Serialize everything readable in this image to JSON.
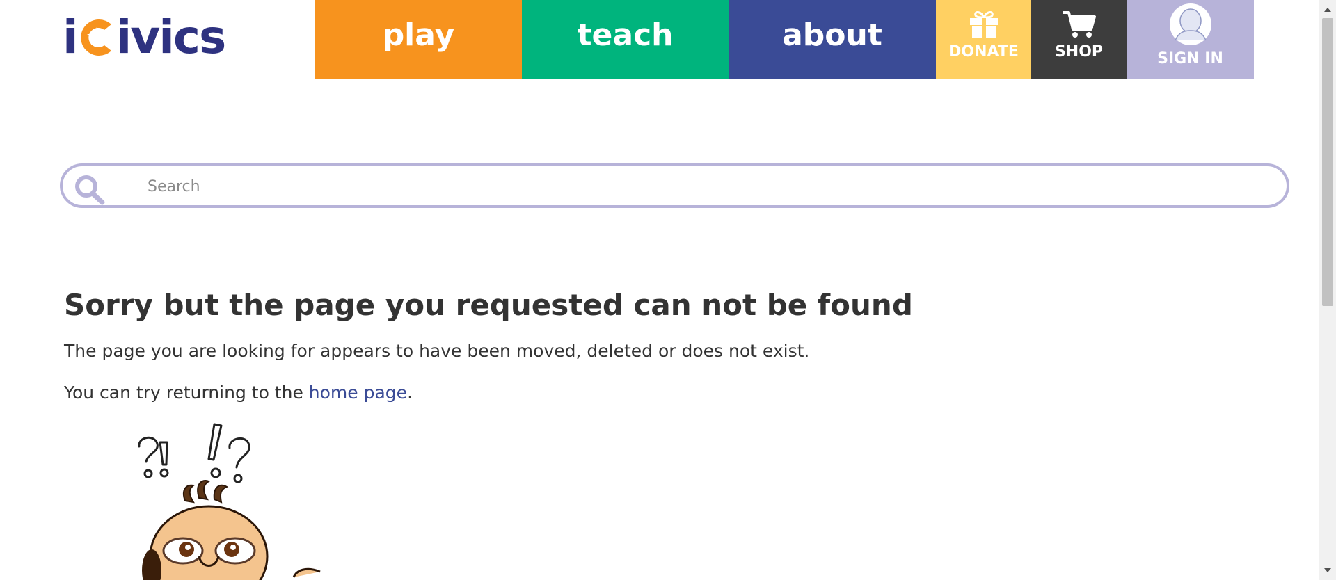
{
  "brand": {
    "logo_text": "iCivics",
    "logo_prefix": "i",
    "logo_suffix": "ivics",
    "colors": {
      "navy": "#2e3280",
      "orange": "#f7931e"
    }
  },
  "nav": {
    "play": {
      "label": "play",
      "color": "#f7931e"
    },
    "teach": {
      "label": "teach",
      "color": "#00b47d"
    },
    "about": {
      "label": "about",
      "color": "#3a4b96"
    },
    "donate": {
      "label": "DONATE",
      "icon": "gift-icon",
      "color": "#ffd062"
    },
    "shop": {
      "label": "SHOP",
      "icon": "cart-icon",
      "color": "#3d3d3d"
    },
    "signin": {
      "label": "SIGN IN",
      "icon": "avatar-icon",
      "color": "#b7b3d9"
    }
  },
  "search": {
    "placeholder": "Search",
    "value": "",
    "icon": "search-icon"
  },
  "content": {
    "title": "Sorry but the page you requested can not be found",
    "paragraph1": "The page you are looking for appears to have been moved, deleted or does not exist.",
    "paragraph2_before": "You can try returning to the ",
    "paragraph2_link": "home page",
    "paragraph2_after": "."
  },
  "illustration": {
    "icon": "confused-character-illustration"
  },
  "scrollbar": {
    "icons": [
      "scroll-up-arrow-icon",
      "scroll-down-arrow-icon"
    ]
  }
}
